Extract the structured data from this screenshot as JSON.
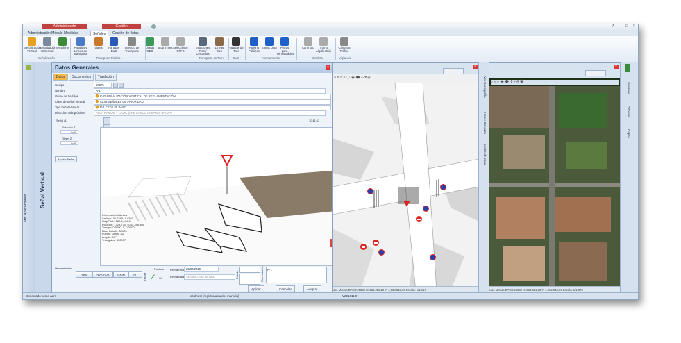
{
  "window": {
    "context_tabs": [
      "Administración",
      "Gestión"
    ],
    "controls": [
      "?",
      "_",
      "□",
      "×"
    ]
  },
  "tabs": [
    {
      "label": "Administración Módulo Movilidad",
      "selected": false
    },
    {
      "label": "Señales",
      "selected": true
    },
    {
      "label": "Gestión de flotas",
      "selected": false
    }
  ],
  "ribbon": {
    "buttons": [
      {
        "label": "Señalización Vertical",
        "icon": "vertical-sign-icon",
        "color": "#e8a020"
      },
      {
        "label": "Señalización Horizontal",
        "icon": "horizontal-sign-icon",
        "color": "#7a8a9c"
      },
      {
        "label": "Semáforos",
        "icon": "traffic-light-icon",
        "color": "#3a8a3a"
      },
      {
        "label": "Paradas y Líneas de Transporte",
        "icon": "bus-stop-icon",
        "color": "#4a7ac8"
      },
      {
        "label": "Viajes",
        "icon": "trips-icon",
        "color": "#c87a2a"
      },
      {
        "label": "Paradas BUS",
        "icon": "bus-icon",
        "color": "#2a5ab8"
      },
      {
        "label": "Servicio de Transporte",
        "icon": "transport-service-icon",
        "color": "#888888"
      },
      {
        "label": "Líneas GEO",
        "icon": "geo-lines-icon",
        "color": "#3a9a5a"
      },
      {
        "label": "Stop Times",
        "icon": "stop-times-icon",
        "color": "#aaaaaa"
      },
      {
        "label": "Seleccionar GTFS",
        "icon": "gtfs-icon",
        "color": "#aaaaaa"
      },
      {
        "label": "Estaciones Tren / Cercanías",
        "icon": "train-station-icon",
        "color": "#5a6a7a"
      },
      {
        "label": "Líneas Tren",
        "icon": "train-lines-icon",
        "color": "#8a6a4a"
      },
      {
        "label": "Paradas de Taxi",
        "icon": "taxi-icon",
        "color": "#333333"
      },
      {
        "label": "Parking Públicos",
        "icon": "parking-icon",
        "color": "#1f5fc8"
      },
      {
        "label": "Zonas ORA",
        "icon": "ora-zone-icon",
        "color": "#1f5fc8"
      },
      {
        "label": "Plazas para Minusválidos",
        "icon": "disabled-parking-icon",
        "color": "#1f5fc8"
      },
      {
        "label": "Carril Bici",
        "icon": "bike-lane-icon",
        "color": "#aaaaaa"
      },
      {
        "label": "Tramo Alquiler Bici",
        "icon": "bike-rental-icon",
        "color": "#aaaaaa"
      },
      {
        "label": "Cámaras Tráfico",
        "icon": "traffic-camera-icon",
        "color": "#888888"
      }
    ],
    "groups": [
      "Señalización",
      "Transporte Público",
      "Transporte en Tren",
      "Taxis",
      "Aparcamiento",
      "Bicicleta",
      "Vigilancia"
    ]
  },
  "left_strip": {
    "label": "Mis Aplicaciones"
  },
  "nav_strip": {
    "label": "Señal Vertical"
  },
  "detail_panel": {
    "title": "Datos Generales",
    "tabs": [
      "Datos",
      "Documentos",
      "Traslación"
    ],
    "fields": [
      {
        "label": "Código",
        "value": "50875"
      },
      {
        "label": "Nombre",
        "value": "R-1"
      },
      {
        "label": "Grupo de Señales",
        "value": "V.02-SEÑALIZACIÓN VERTICAL DE REGLAMENTACIÓN"
      },
      {
        "label": "Clase de Señal Vertical",
        "value": "02.02-SEÑALES DE PRIORIDAD"
      },
      {
        "label": "Tipo Señal Vertical",
        "value": "R-1 CEDA EL PASO"
      },
      {
        "label": "Dirección más próxima",
        "value": "AVDA RAMÓN Y CAJAL (URB CASCO URBANO) Nº 0070"
      }
    ],
    "signal_label": "Señal (1)",
    "rotation_label": "Rotación Z",
    "rotation_value": "0,00",
    "offset_label": "Offset Z",
    "offset_value": "0,00",
    "adjust_button": "Ajustar Señal",
    "scene_time": "10:11:13",
    "scene_info": [
      "Información Cámara",
      "Lat/Lon: 36.7280,-4.4203",
      "Hdg/Pitch: 182.4, -24.1",
      "Posición: 1329,770, 4063,346,366",
      "Tiempo: 0,0000, 0, 0 0000",
      "Nivel Detalle: 50000",
      "Fuente Datos: 3D",
      "Ángulo: 90°",
      "Triángulos: 302937"
    ],
    "controls_label": "Herramientas",
    "controls": [
      "Fuera",
      "PANCRUX",
      "ZOOM",
      "INIT"
    ],
    "tracker_label": "Tracker",
    "published_label": "Publicar",
    "published_value": "Sí",
    "date_label": "Fecha Registro",
    "date_value": "25/07/2016",
    "off_label": "Fecha Baja",
    "off_placeholder": "Señal no está de baja",
    "state_label": "Estado",
    "comments_label": "Comentarios",
    "comments_value": "R-1",
    "apply": "Aplicar",
    "cancel": "Cancelar",
    "accept": "Aceptar"
  },
  "map_left": {
    "side_labels": [
      "Ver Cartografía",
      "Hacer Consulta",
      "Limite de zona"
    ],
    "status": "Uso Metros   EPSG:25830   X: 331.255,20   Y: 4.068.913,30   Escala: 1/1.157"
  },
  "map_right": {
    "side_labels": [
      "Servicios",
      "Ortofoto",
      "Capas"
    ],
    "status": "Uso Metros   EPSG:25830   X: 330.621,30   Y: 4.062.940,09   Escala: 1/1.370"
  },
  "app_status": {
    "connection": "Conectado como adm",
    "user": "localhost (registro/usuario, marcela)",
    "version": "V201611.0"
  }
}
